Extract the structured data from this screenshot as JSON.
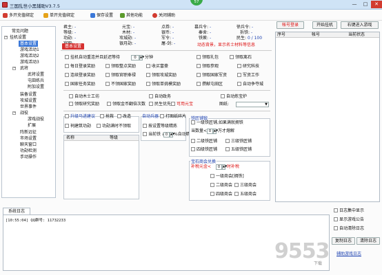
{
  "window": {
    "title": "三国乱世小黑辅助V3.7.5",
    "badge": "57",
    "min": "—",
    "max": "□",
    "close": "✕"
  },
  "toolbar": {
    "items": [
      {
        "label": "多开充值绑定",
        "color": "#d23b30"
      },
      {
        "label": "单开充值绑定",
        "color": "#e5a219"
      },
      {
        "label": "保存设置",
        "color": "#3b78d8"
      },
      {
        "label": "其他功能",
        "color": "#5b9a2b"
      },
      {
        "label": "关闭辅助",
        "color": "#d23b30"
      }
    ]
  },
  "tree": {
    "items": [
      {
        "label": "常见问题"
      },
      {
        "label": "挂机设置",
        "expander": "−"
      },
      {
        "label": "基本设置",
        "selected": true
      },
      {
        "label": "游戏活动1"
      },
      {
        "label": "游戏活动2"
      },
      {
        "label": "游戏活动3"
      },
      {
        "label": "武将",
        "expander": "−"
      },
      {
        "label": "武将设置"
      },
      {
        "label": "屯田练兵"
      },
      {
        "label": "附加设置"
      },
      {
        "label": "装备设置"
      },
      {
        "label": "攻城设置"
      },
      {
        "label": "世界事件"
      },
      {
        "label": "战役",
        "expander": "−"
      },
      {
        "label": "游戏战役"
      },
      {
        "label": "扩展"
      },
      {
        "label": "阵新远征"
      },
      {
        "label": "市场设置"
      },
      {
        "label": "聊天窗口"
      },
      {
        "label": "功勋检测"
      },
      {
        "label": "手动操作"
      }
    ]
  },
  "stats": {
    "col1": [
      {
        "k": "君主:",
        "v": "-"
      },
      {
        "k": "等级:",
        "v": "-"
      },
      {
        "k": "功勋:",
        "v": "-"
      },
      {
        "k": "官职:",
        "v": "-"
      }
    ],
    "col2": [
      {
        "k": "元宝:",
        "v": "-"
      },
      {
        "k": "木材:",
        "v": "-"
      },
      {
        "k": "攻城勋:",
        "v": "-"
      },
      {
        "k": "银月勋:",
        "v": "-"
      }
    ],
    "col3": [
      {
        "k": "点券:",
        "v": "-"
      },
      {
        "k": "银币:",
        "v": "-"
      },
      {
        "k": "军令:",
        "v": "-"
      },
      {
        "k": "屠-剑:",
        "v": "-"
      }
    ],
    "col4": [
      {
        "k": "募兵令:",
        "v": "-"
      },
      {
        "k": "秦舍:",
        "v": "-"
      },
      {
        "k": "铁蒺:",
        "v": "-"
      }
    ],
    "col5": [
      {
        "k": "徐兵令:",
        "v": "-"
      },
      {
        "k": "拆铁:",
        "v": "-"
      },
      {
        "k": "民生:",
        "v": "0 / 100"
      }
    ],
    "status_msg": "动态背景，显示名士材料等信息"
  },
  "tabs": {
    "active": "基本设置"
  },
  "opts": {
    "r1": {
      "a": "挂机自动重连并且延迟等待",
      "v": "0",
      "unit": "分钟",
      "b": "领取礼包",
      "c": "领取离石"
    },
    "r2": {
      "a": "每日登录奖励",
      "b": "领取整点奖励",
      "c": "收买富豪",
      "d": "领取参观",
      "e": "研究科技"
    },
    "r3": {
      "a": "连续登录奖励",
      "b": "领取官职奉禄",
      "c": "领取攻城奖励",
      "d": "领取国家军资",
      "e": "军资工作"
    },
    "r4": {
      "a": "国家任务奖励",
      "b": "不领国家奖励",
      "c": "领取单挑模奖励",
      "d": "攒献屯田区",
      "e": "自动争夺城"
    },
    "r5": {
      "a": "自动木士工坊",
      "b": "自动政务",
      "c": "自动炼宝炉"
    },
    "r6": {
      "a": "领取研究奖励",
      "b": "领取金币翻倍次数",
      "c": "民生优先",
      "d": "可用元宝",
      "e": "图纸:"
    },
    "r7": {
      "a": "升级马进建议",
      "b": "抢救",
      "c": "改造",
      "d": "自动兵器",
      "e": "打图纸碎片"
    },
    "r8": {
      "a": "祠建筑功勋",
      "b": "功勋满时不领取",
      "c": "按设置等级精炼"
    },
    "r9": {
      "a": "当前铁 ≥",
      "v": "0",
      "unit": "%自动精炼"
    }
  },
  "minion": {
    "headers": [
      "名称",
      "等级"
    ]
  },
  "iron": {
    "title": "铁匠铺锻",
    "rows": [
      {
        "a": "一级铁匠铺,如果满就拥铁"
      },
      {
        "a": "当数量<",
        "v": "0",
        "unit": "万才熔解"
      },
      {
        "a": "二级铁匠铺",
        "b": "三级铁匠铺"
      },
      {
        "a": "四级铁匠铺",
        "b": "五级铁匠铺"
      }
    ]
  },
  "gem": {
    "title": "宝石商会兑换",
    "cond": "补税元金<",
    "v": "0",
    "unit": "时补税",
    "rows": [
      {
        "a": "一级商会[拥铁]"
      },
      {
        "a": "二级商会",
        "b": "三级商会"
      },
      {
        "a": "四级商会",
        "b": "五级商会"
      }
    ]
  },
  "right": {
    "buttons": [
      "帐号登录",
      "开始挂机",
      "右键进入游戏"
    ],
    "headers": [
      "序号",
      "帐号",
      "当前状态"
    ]
  },
  "log": {
    "tab": "系统日志",
    "line": "[10:55:04] QQ群号: 11732233",
    "opts": [
      "日志集中显示",
      "显示游戏公告",
      "自动清除日志"
    ],
    "btns": [
      "复制日志",
      "清除日志"
    ],
    "link": "辅助游戏日志"
  },
  "watermark": {
    "text": "9553",
    "sub": "下载"
  }
}
